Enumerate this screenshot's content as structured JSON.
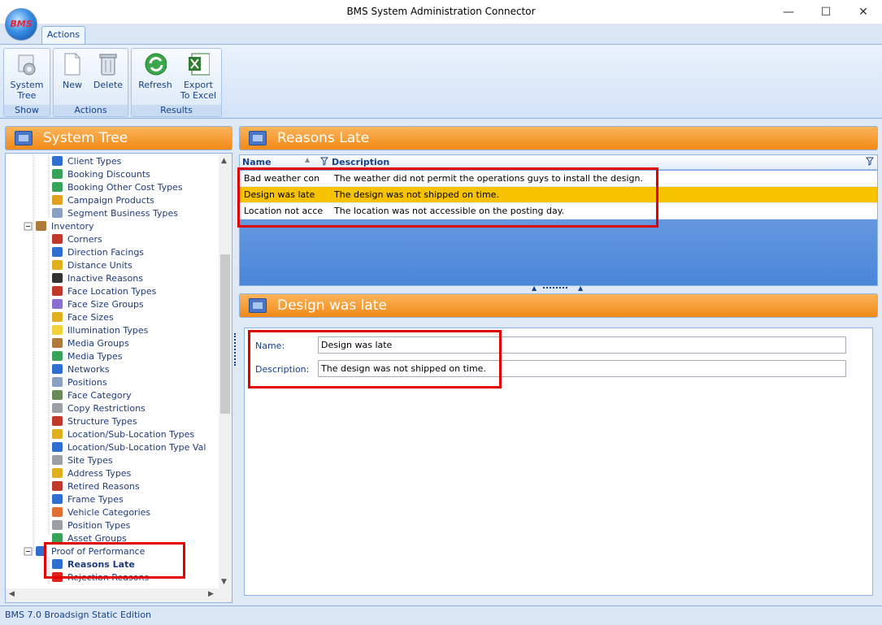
{
  "window": {
    "title": "BMS System Administration Connector",
    "minimize": "—",
    "maximize": "☐",
    "close": "✕"
  },
  "app_logo": "BMS",
  "ribbon": {
    "tab": "Actions",
    "groups": [
      {
        "label": "Show",
        "buttons": [
          {
            "label": "System Tree",
            "icon": "system-tree-icon"
          }
        ]
      },
      {
        "label": "Actions",
        "buttons": [
          {
            "label": "New",
            "icon": "new-document-icon"
          },
          {
            "label": "Delete",
            "icon": "trash-icon"
          }
        ]
      },
      {
        "label": "Results",
        "buttons": [
          {
            "label": "Refresh",
            "icon": "refresh-icon"
          },
          {
            "label": "Export To Excel",
            "icon": "excel-icon"
          }
        ]
      }
    ]
  },
  "left_panel": {
    "title": "System Tree",
    "items": [
      {
        "label": "Client Types",
        "color": "#2f6fd1"
      },
      {
        "label": "Booking Discounts",
        "color": "#3aa35b"
      },
      {
        "label": "Booking Other Cost Types",
        "color": "#3aa35b"
      },
      {
        "label": "Campaign Products",
        "color": "#e0a020"
      },
      {
        "label": "Segment Business Types",
        "color": "#8aa0c0"
      },
      {
        "label": "Inventory",
        "color": "#b07a3a"
      },
      {
        "label": "Corners",
        "color": "#c0392b"
      },
      {
        "label": "Direction Facings",
        "color": "#2f6fd1"
      },
      {
        "label": "Distance Units",
        "color": "#e0b020"
      },
      {
        "label": "Inactive Reasons",
        "color": "#333333"
      },
      {
        "label": "Face Location Types",
        "color": "#c0392b"
      },
      {
        "label": "Face Size Groups",
        "color": "#8a6fd1"
      },
      {
        "label": "Face Sizes",
        "color": "#e0b020"
      },
      {
        "label": "Illumination Types",
        "color": "#f2d23a"
      },
      {
        "label": "Media Groups",
        "color": "#b07a3a"
      },
      {
        "label": "Media Types",
        "color": "#3aa35b"
      },
      {
        "label": "Networks",
        "color": "#2f6fd1"
      },
      {
        "label": "Positions",
        "color": "#8aa0c0"
      },
      {
        "label": "Face Category",
        "color": "#6a8a5a"
      },
      {
        "label": "Copy Restrictions",
        "color": "#9aa0a8"
      },
      {
        "label": "Structure Types",
        "color": "#c0392b"
      },
      {
        "label": "Location/Sub-Location Types",
        "color": "#e0b020"
      },
      {
        "label": "Location/Sub-Location Type Val",
        "color": "#2f6fd1"
      },
      {
        "label": "Site Types",
        "color": "#9aa0a8"
      },
      {
        "label": "Address Types",
        "color": "#e0b020"
      },
      {
        "label": "Retired Reasons",
        "color": "#c0392b"
      },
      {
        "label": "Frame Types",
        "color": "#2f6fd1"
      },
      {
        "label": "Vehicle Categories",
        "color": "#e07030"
      },
      {
        "label": "Position Types",
        "color": "#9aa0a8"
      },
      {
        "label": "Asset Groups",
        "color": "#3aa35b"
      },
      {
        "label": "Proof of Performance",
        "color": "#2f6fd1"
      },
      {
        "label": "Reasons Late",
        "color": "#2f6fd1"
      },
      {
        "label": "Rejection Reasons",
        "color": "#e02020"
      }
    ]
  },
  "grid_panel": {
    "title": "Reasons Late",
    "columns": {
      "name": "Name",
      "description": "Description"
    },
    "rows": [
      {
        "name": "Bad weather con",
        "description": "The weather did not permit the operations guys to install the design."
      },
      {
        "name": "Design was late",
        "description": "The design was not shipped on time."
      },
      {
        "name": "Location not acce",
        "description": "The location was not accessible on the posting day."
      }
    ],
    "selected_row": 1
  },
  "detail_panel": {
    "title": "Design was late",
    "name_label": "Name:",
    "name_value": "Design was late",
    "description_label": "Description:",
    "description_value": "The design was not shipped on time."
  },
  "status_bar": {
    "text": "BMS 7.0 Broadsign Static Edition"
  },
  "colors": {
    "accent_orange": "#f18a17",
    "selection": "#f7c200",
    "highlight_red": "#e00000",
    "ribbon_blue": "#15428b"
  }
}
